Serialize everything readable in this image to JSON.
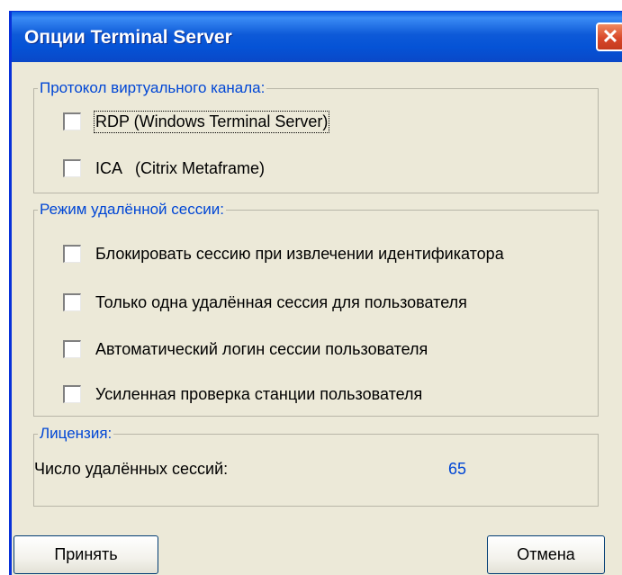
{
  "window": {
    "title": "Опции Terminal Server",
    "close_label": "✕"
  },
  "protocol_group": {
    "legend": "Протокол виртуального канала:",
    "options": [
      {
        "label": "RDP (Windows Terminal Server)",
        "checked": false
      },
      {
        "label": "ICA   (Citrix Metaframe)",
        "checked": false
      }
    ]
  },
  "session_group": {
    "legend": "Режим удалённой сессии:",
    "options": [
      {
        "label": "Блокировать сессию при извлечении идентификатора",
        "checked": false
      },
      {
        "label": "Только одна удалённая сессия для пользователя",
        "checked": false
      },
      {
        "label": "Автоматический логин сессии пользователя",
        "checked": false
      },
      {
        "label": "Усиленная проверка станции пользователя",
        "checked": false
      }
    ]
  },
  "license_group": {
    "legend": "Лицензия:",
    "sessions_label": "Число удалённых сессий:",
    "sessions_value": "65"
  },
  "buttons": {
    "accept": "Принять",
    "cancel": "Отмена"
  },
  "colors": {
    "titlebar": "#0553d6",
    "window_bg": "#ece9d8",
    "legend_text": "#0046d5",
    "close": "#d8482a"
  }
}
